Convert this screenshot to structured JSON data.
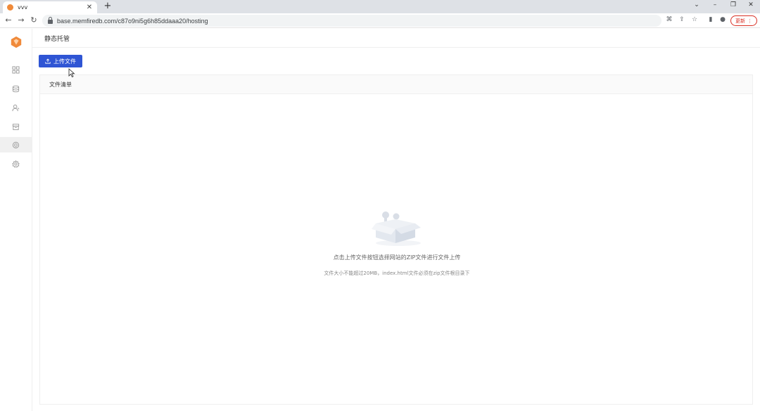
{
  "browser": {
    "tab_title": "vvv",
    "url": "base.memfiredb.com/c87o9ni5g6h85ddaaa20/hosting",
    "update_label": "更新"
  },
  "page": {
    "title": "静态托管"
  },
  "toolbar": {
    "upload_label": "上传文件"
  },
  "file_list": {
    "header": "文件清单",
    "empty_main": "点击上传文件按钮选择网站的ZIP文件进行文件上传",
    "empty_sub": "文件大小不能超过20MB，index.html文件必须在zip文件根目录下"
  },
  "sidebar": {
    "items": [
      {
        "icon": "grid-icon"
      },
      {
        "icon": "database-icon"
      },
      {
        "icon": "user-icon"
      },
      {
        "icon": "storage-box-icon"
      },
      {
        "icon": "hosting-icon",
        "active": true
      },
      {
        "icon": "gear-icon"
      }
    ]
  },
  "colors": {
    "primary": "#2f55d4",
    "logo": "#f08a3a",
    "update": "#d93025"
  }
}
